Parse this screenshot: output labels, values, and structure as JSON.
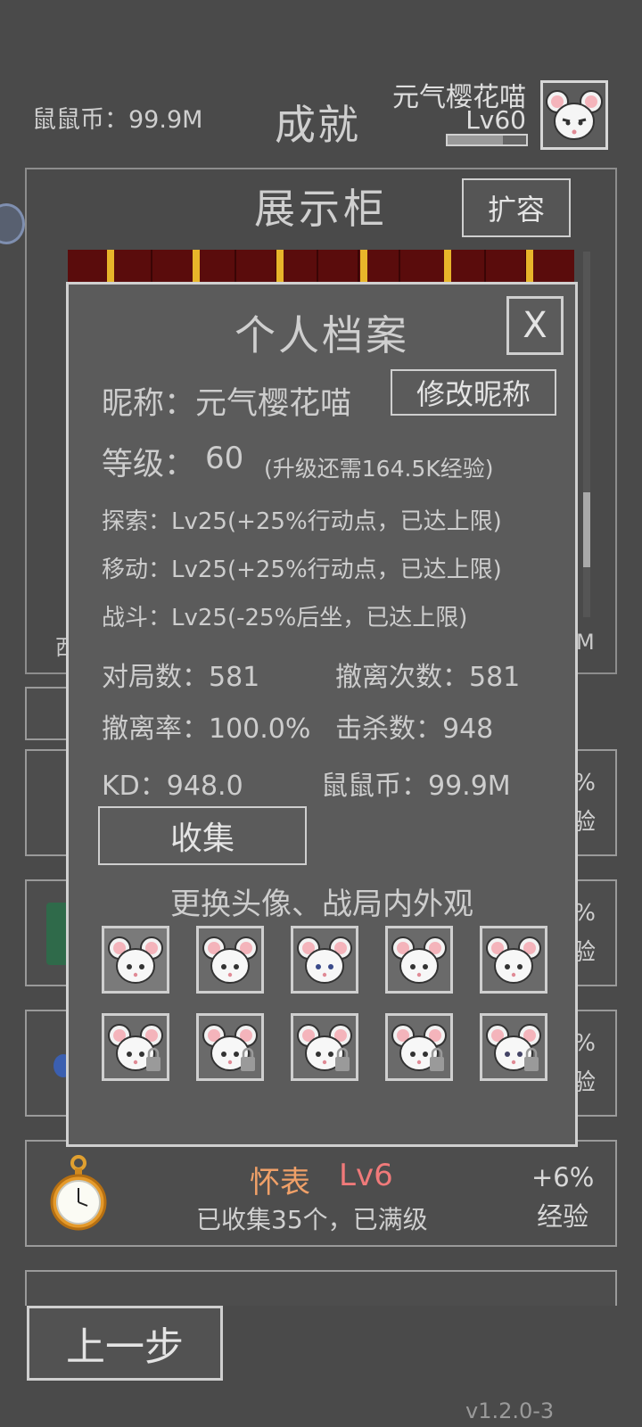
{
  "header": {
    "coins": "鼠鼠币：99.9M",
    "title": "成就",
    "player_name": "元气樱花喵",
    "player_level": "Lv60",
    "xp_progress": 0.7
  },
  "showcase": {
    "title": "展示柜",
    "expand_label": "扩容",
    "edge_left": "西",
    "edge_right": "M"
  },
  "bg_cards": [
    {
      "bonus_pct": "%",
      "bonus_label": "验"
    },
    {
      "bonus_pct": "%",
      "bonus_label": "验"
    },
    {
      "bonus_pct": "%",
      "bonus_label": "验"
    }
  ],
  "watch_item": {
    "name": "怀表",
    "level": "Lv6",
    "desc": "已收集35个，已满级",
    "bonus_pct": "+6%",
    "bonus_label": "经验"
  },
  "back_label": "上一步",
  "version": "v1.2.0-3",
  "profile": {
    "title": "个人档案",
    "close_label": "X",
    "nickname": "昵称：元气樱花喵",
    "rename_label": "修改昵称",
    "level_label": "等级：",
    "level_value": "60",
    "level_note": "(升级还需164.5K经验)",
    "skills": [
      "探索：Lv25(+25%行动点，已达上限)",
      "移动：Lv25(+25%行动点，已达上限)",
      "战斗：Lv25(-25%后坐，已达上限)"
    ],
    "stats": {
      "matches": "对局数：581",
      "extractions": "撤离次数：581",
      "extract_rate": "撤离率：100.0%",
      "kills": "击杀数：948",
      "kd": "KD：948.0",
      "coins": "鼠鼠币：99.9M"
    },
    "collect_label": "收集",
    "skins_title": "更换头像、战局内外观",
    "skins": [
      {
        "id": "mouse-avatar-1",
        "locked": false,
        "selected": true
      },
      {
        "id": "mouse-avatar-2",
        "locked": false,
        "selected": false
      },
      {
        "id": "mouse-avatar-3",
        "locked": false,
        "selected": false
      },
      {
        "id": "mouse-avatar-4",
        "locked": false,
        "selected": false
      },
      {
        "id": "mouse-avatar-5",
        "locked": false,
        "selected": false
      },
      {
        "id": "mouse-avatar-6",
        "locked": true,
        "selected": false
      },
      {
        "id": "mouse-avatar-7",
        "locked": true,
        "selected": false
      },
      {
        "id": "mouse-avatar-8",
        "locked": true,
        "selected": false
      },
      {
        "id": "mouse-avatar-9",
        "locked": true,
        "selected": false
      },
      {
        "id": "mouse-avatar-10",
        "locked": true,
        "selected": false
      }
    ]
  }
}
